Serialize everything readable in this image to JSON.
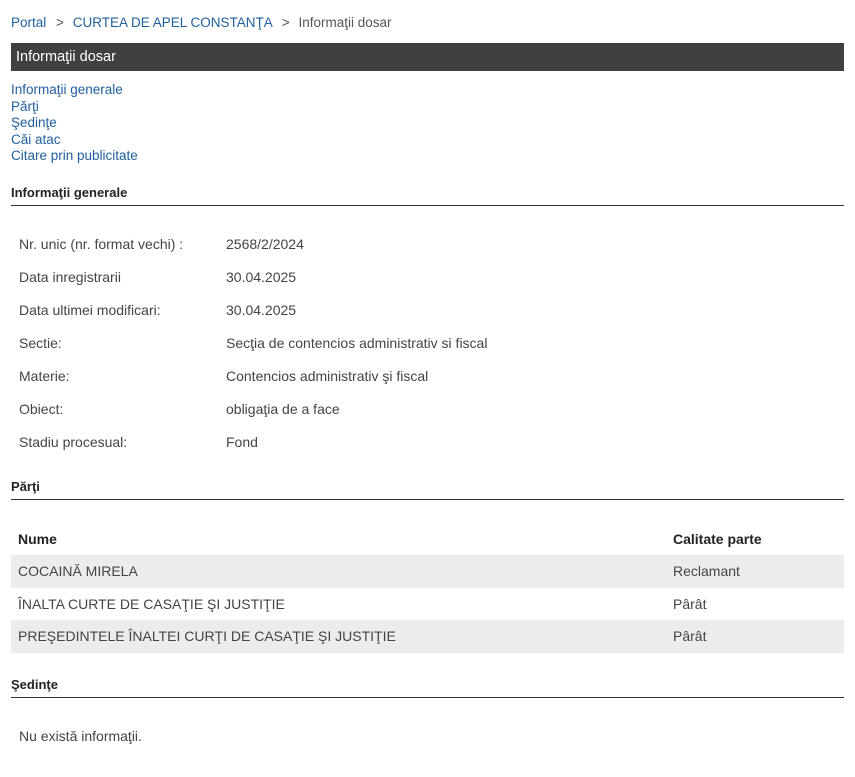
{
  "breadcrumb": {
    "items": [
      "Portal",
      "CURTEA DE APEL CONSTANŢA"
    ],
    "separator": ">",
    "current": "Informaţii dosar"
  },
  "title_bar": "Informaţii dosar",
  "nav_links": [
    "Informaţii generale",
    "Părţi",
    "Şedinţe",
    "Căi atac",
    "Citare prin publicitate"
  ],
  "sections": {
    "general": "Informaţii generale",
    "parti": "Părţi",
    "sedinte": "Şedinţe"
  },
  "general_info": [
    {
      "label": "Nr. unic (nr. format vechi) :",
      "value": "2568/2/2024"
    },
    {
      "label": "Data inregistrarii",
      "value": "30.04.2025"
    },
    {
      "label": "Data ultimei modificari:",
      "value": "30.04.2025"
    },
    {
      "label": "Sectie:",
      "value": "Secţia de contencios administrativ si fiscal"
    },
    {
      "label": "Materie:",
      "value": "Contencios administrativ şi fiscal"
    },
    {
      "label": "Obiect:",
      "value": "obligaţia de a face"
    },
    {
      "label": "Stadiu procesual:",
      "value": "Fond"
    }
  ],
  "parties": {
    "headers": {
      "name": "Nume",
      "calitate": "Calitate parte"
    },
    "rows": [
      {
        "name": "COCAINĂ MIRELA",
        "calitate": "Reclamant"
      },
      {
        "name": "ÎNALTA CURTE DE CASAŢIE ŞI JUSTIŢIE",
        "calitate": "Pârât"
      },
      {
        "name": "PREŞEDINTELE ÎNALTEI CURŢI DE CASAŢIE ŞI JUSTIŢIE",
        "calitate": "Pârât"
      }
    ]
  },
  "sedinte": {
    "empty_message": "Nu există informaţii."
  },
  "colors": {
    "link": "#1f5f9f",
    "title_bar_bg": "#404040",
    "row_shade": "#ececec"
  }
}
